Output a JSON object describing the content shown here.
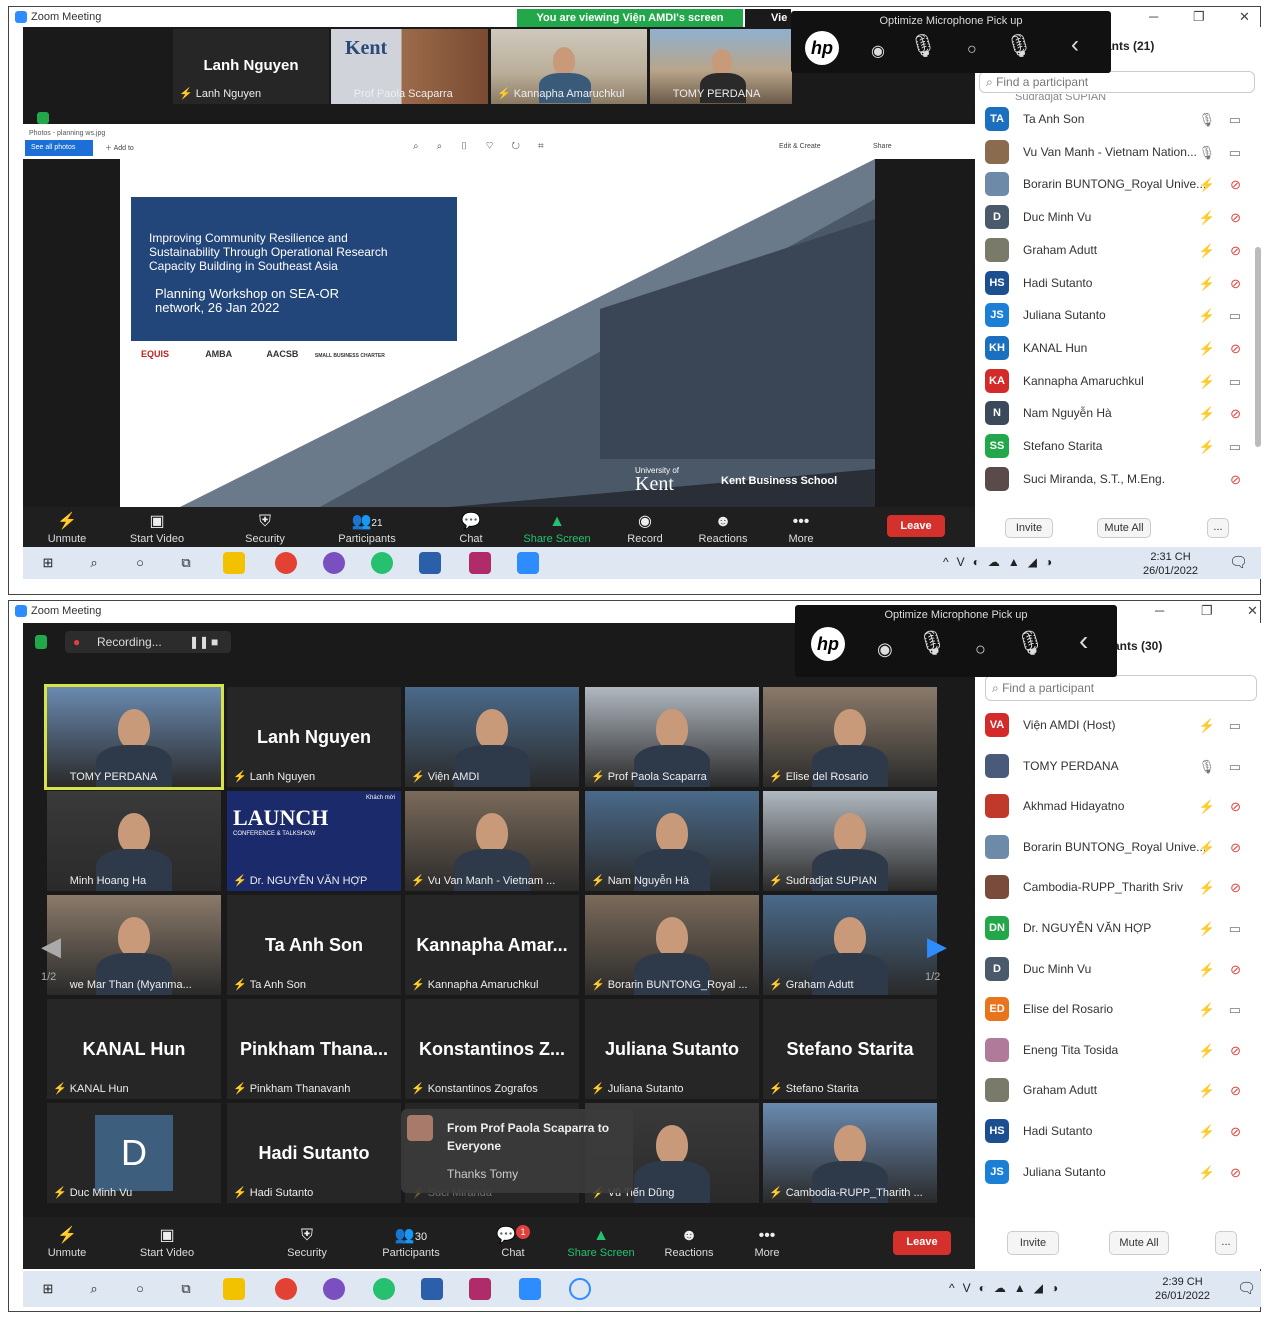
{
  "s1": {
    "title": "Zoom Meeting",
    "banner": "You are viewing Viện AMDI's screen",
    "banner_tail": "Vie",
    "hp_title": "Optimize Microphone Pick up",
    "participants_header": "ants (21)",
    "search_placeholder": "Find a participant",
    "partial_row": "Sudradjat SUPIAN",
    "thumbs": [
      {
        "name": "Lanh Nguyen",
        "big": "Lanh Nguyen"
      },
      {
        "name": "Prof Paola Scaparra"
      },
      {
        "name": "Kannapha Amaruchkul"
      },
      {
        "name": "TOMY PERDANA"
      }
    ],
    "photos_bar": "Photos - planning ws.jpg",
    "photos_btn": "See all photos",
    "photos_add": "Add to",
    "photos_edit": "Edit & Create",
    "photos_share": "Share",
    "slide": {
      "line1": "Improving Community Resilience and",
      "line2": "Sustainability Through Operational Research",
      "line3": "Capacity Building in Southeast Asia",
      "line4": "Planning Workshop on SEA-OR",
      "line5": "network, 26 Jan 2022",
      "logos": [
        "EQUIS",
        "AMBA",
        "AACSB",
        "SMALL BUSINESS CHARTER"
      ],
      "uni_small": "University of",
      "uni": "Kent",
      "school": "Kent Business School"
    },
    "participants": [
      {
        "init": "TA",
        "color": "#1b6fbf",
        "name": "Ta Anh Son",
        "mic": "on",
        "cam": "on"
      },
      {
        "init": "",
        "color": "#8a6b4e",
        "name": "Vu Van Manh - Vietnam Nation...",
        "mic": "on",
        "cam": "on"
      },
      {
        "init": "",
        "color": "#6d8aa8",
        "name": "Borarin BUNTONG_Royal Unive...",
        "mic": "off",
        "cam": "off"
      },
      {
        "init": "D",
        "color": "#4a5a6a",
        "name": "Duc Minh Vu",
        "mic": "off",
        "cam": "off"
      },
      {
        "init": "",
        "color": "#7a7a6a",
        "name": "Graham Adutt",
        "mic": "off",
        "cam": "off"
      },
      {
        "init": "HS",
        "color": "#1b4f8f",
        "name": "Hadi Sutanto",
        "mic": "off",
        "cam": "off"
      },
      {
        "init": "JS",
        "color": "#1b7fd6",
        "name": "Juliana Sutanto",
        "mic": "off",
        "cam": "on"
      },
      {
        "init": "KH",
        "color": "#1b6fbf",
        "name": "KANAL Hun",
        "mic": "off",
        "cam": "off"
      },
      {
        "init": "KA",
        "color": "#d42a2a",
        "name": "Kannapha Amaruchkul",
        "mic": "off",
        "cam": "on"
      },
      {
        "init": "N",
        "color": "#3a4a5a",
        "name": "Nam Nguyễn Hà",
        "mic": "off",
        "cam": "off"
      },
      {
        "init": "SS",
        "color": "#22a84a",
        "name": "Stefano Starita",
        "mic": "off",
        "cam": "on"
      },
      {
        "init": "",
        "color": "#5a4a4a",
        "name": "Suci Miranda, S.T., M.Eng.",
        "mic": "none",
        "cam": "off"
      }
    ],
    "invite": "Invite",
    "mute_all": "Mute All",
    "more_btn": "...",
    "toolbar": {
      "unmute": "Unmute",
      "video": "Start Video",
      "security": "Security",
      "participants": "Participants",
      "count": "21",
      "chat": "Chat",
      "share": "Share Screen",
      "record": "Record",
      "reactions": "Reactions",
      "more": "More",
      "leave": "Leave"
    },
    "clock_time": "2:31 CH",
    "clock_date": "26/01/2022"
  },
  "s2": {
    "title": "Zoom Meeting",
    "recording": "Recording...",
    "hp_title": "Optimize Microphone Pick up",
    "participants_header": "ants (30)",
    "search_placeholder": "Find a participant",
    "page_left": "1/2",
    "page_right": "1/2",
    "grid": [
      {
        "name": "TOMY PERDANA",
        "type": "photo",
        "mic": "none"
      },
      {
        "name": "Lanh Nguyen",
        "big": "Lanh Nguyen",
        "type": "name"
      },
      {
        "name": "Viện AMDI",
        "type": "photo"
      },
      {
        "name": "Prof Paola Scaparra",
        "type": "photo"
      },
      {
        "name": "Elise del Rosario",
        "type": "photo"
      },
      {
        "name": "Minh Hoang Ha",
        "type": "photo",
        "mic": "none"
      },
      {
        "name": "Dr. NGUYỄN VĂN HỢP",
        "type": "launch",
        "launch": "LAUNCH",
        "launch_sub": "CONFERENCE & TALKSHOW",
        "launch_corner": "Khách mời"
      },
      {
        "name": "Vu Van Manh - Vietnam ...",
        "type": "photo"
      },
      {
        "name": "Nam Nguyễn Hà",
        "type": "photo"
      },
      {
        "name": "Sudradjat SUPIAN",
        "type": "photo"
      },
      {
        "name": "we Mar Than (Myanma...",
        "type": "photo",
        "mic": "none"
      },
      {
        "name": "Ta Anh Son",
        "big": "Ta Anh Son",
        "type": "name"
      },
      {
        "name": "Kannapha Amaruchkul",
        "big": "Kannapha  Amar...",
        "type": "name"
      },
      {
        "name": "Borarin BUNTONG_Royal ...",
        "type": "photo"
      },
      {
        "name": "Graham Adutt",
        "type": "photo"
      },
      {
        "name": "KANAL Hun",
        "big": "KANAL Hun",
        "type": "name"
      },
      {
        "name": "Pinkham Thanavanh",
        "big": "Pinkham  Thana...",
        "type": "name"
      },
      {
        "name": "Konstantinos Zografos",
        "big": "Konstantinos  Z...",
        "type": "name"
      },
      {
        "name": "Juliana Sutanto",
        "big": "Juliana Sutanto",
        "type": "name"
      },
      {
        "name": "Stefano Starita",
        "big": "Stefano Starita",
        "type": "name"
      },
      {
        "name": "Duc Minh Vu",
        "type": "letter",
        "letter": "D"
      },
      {
        "name": "Hadi Sutanto",
        "big": "Hadi Sutanto",
        "type": "name"
      },
      {
        "name": "Suci Miranda",
        "type": "chatcover"
      },
      {
        "name": "Vũ Tiến Dũng",
        "type": "photo"
      },
      {
        "name": "Cambodia-RUPP_Tharith ...",
        "type": "photo"
      }
    ],
    "chat_popup": {
      "from": "From Prof Paola Scaparra to Everyone",
      "msg": "Thanks Tomy"
    },
    "participants": [
      {
        "init": "VA",
        "color": "#d42a2a",
        "name": "Viện AMDI (Host)",
        "mic": "off",
        "cam": "on"
      },
      {
        "init": "",
        "color": "#4a5a7a",
        "name": "TOMY PERDANA",
        "mic": "on",
        "cam": "on"
      },
      {
        "init": "",
        "color": "#c0392b",
        "name": "Akhmad Hidayatno",
        "mic": "off",
        "cam": "off"
      },
      {
        "init": "",
        "color": "#6d8aa8",
        "name": "Borarin BUNTONG_Royal Unive...",
        "mic": "off",
        "cam": "off"
      },
      {
        "init": "",
        "color": "#7a4a3a",
        "name": "Cambodia-RUPP_Tharith Sriv",
        "mic": "off",
        "cam": "off"
      },
      {
        "init": "DN",
        "color": "#22a84a",
        "name": "Dr. NGUYỄN VĂN HỢP",
        "mic": "off",
        "cam": "on"
      },
      {
        "init": "D",
        "color": "#4a5a6a",
        "name": "Duc Minh Vu",
        "mic": "off",
        "cam": "off"
      },
      {
        "init": "ED",
        "color": "#e8741c",
        "name": "Elise del Rosario",
        "mic": "off",
        "cam": "on"
      },
      {
        "init": "",
        "color": "#b07a9a",
        "name": "Eneng Tita Tosida",
        "mic": "off",
        "cam": "off"
      },
      {
        "init": "",
        "color": "#7a7a6a",
        "name": "Graham Adutt",
        "mic": "off",
        "cam": "off"
      },
      {
        "init": "HS",
        "color": "#1b4f8f",
        "name": "Hadi Sutanto",
        "mic": "off",
        "cam": "off"
      },
      {
        "init": "JS",
        "color": "#1b7fd6",
        "name": "Juliana Sutanto",
        "mic": "off",
        "cam": "off"
      }
    ],
    "invite": "Invite",
    "mute_all": "Mute All",
    "more_btn": "...",
    "toolbar": {
      "unmute": "Unmute",
      "video": "Start Video",
      "security": "Security",
      "participants": "Participants",
      "count": "30",
      "chat": "Chat",
      "chat_badge": "1",
      "share": "Share Screen",
      "reactions": "Reactions",
      "more": "More",
      "leave": "Leave"
    },
    "clock_time": "2:39 CH",
    "clock_date": "26/01/2022"
  }
}
